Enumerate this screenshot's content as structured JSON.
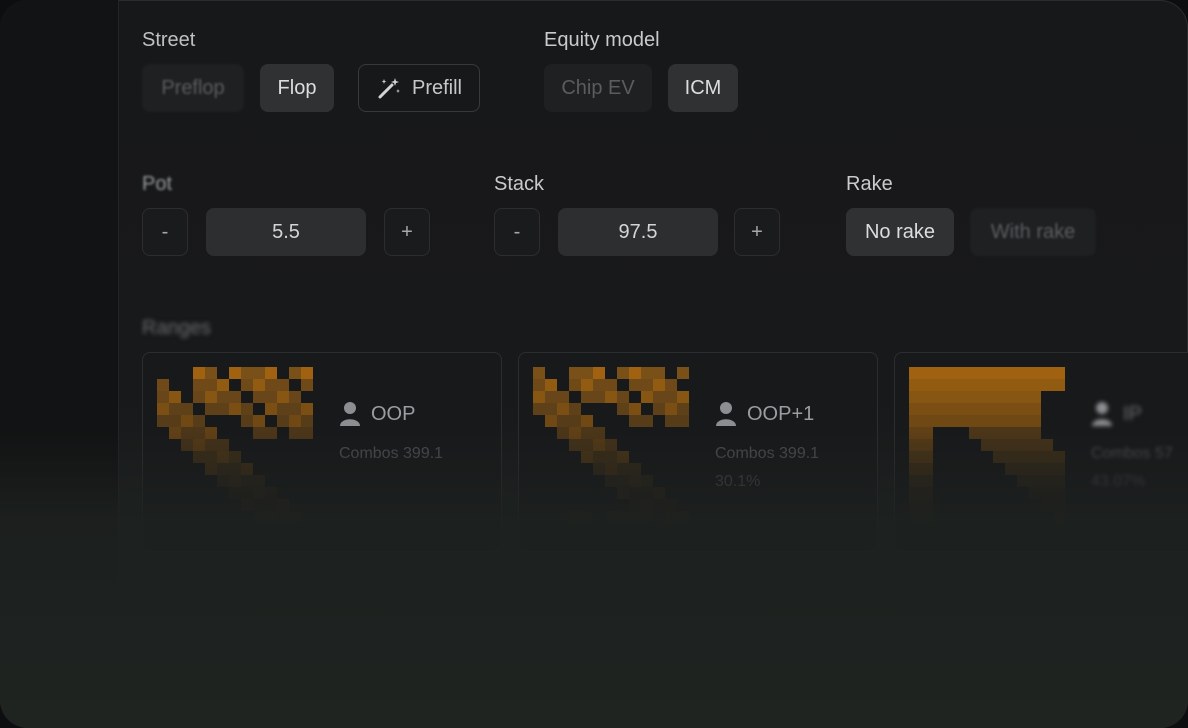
{
  "street": {
    "label": "Street",
    "options": [
      "Preflop",
      "Flop"
    ],
    "selected": "Flop",
    "prefill_label": "Prefill"
  },
  "equity_model": {
    "label": "Equity model",
    "options": [
      "Chip EV",
      "ICM"
    ],
    "selected": "ICM"
  },
  "pot": {
    "label": "Pot",
    "value": "5.5",
    "minus": "-",
    "plus": "+"
  },
  "stack": {
    "label": "Stack",
    "value": "97.5",
    "minus": "-",
    "plus": "+"
  },
  "rake": {
    "label": "Rake",
    "options": [
      "No rake",
      "With rake"
    ],
    "selected": "No rake"
  },
  "ranges": {
    "label": "Ranges",
    "cards": [
      {
        "player": "OOP",
        "combos": "Combos 399.1",
        "percent": ""
      },
      {
        "player": "OOP+1",
        "combos": "Combos 399.1",
        "percent": "30.1%"
      },
      {
        "player": "IP",
        "combos": "Combos 57",
        "percent": "43.07%"
      }
    ]
  },
  "colors": {
    "accent": "#c87a10",
    "background": "#17181a",
    "button_selected": "#303133",
    "button_unselected": "#1f2022"
  },
  "icons": {
    "prefill": "magic-wand-icon",
    "player": "user-icon"
  }
}
